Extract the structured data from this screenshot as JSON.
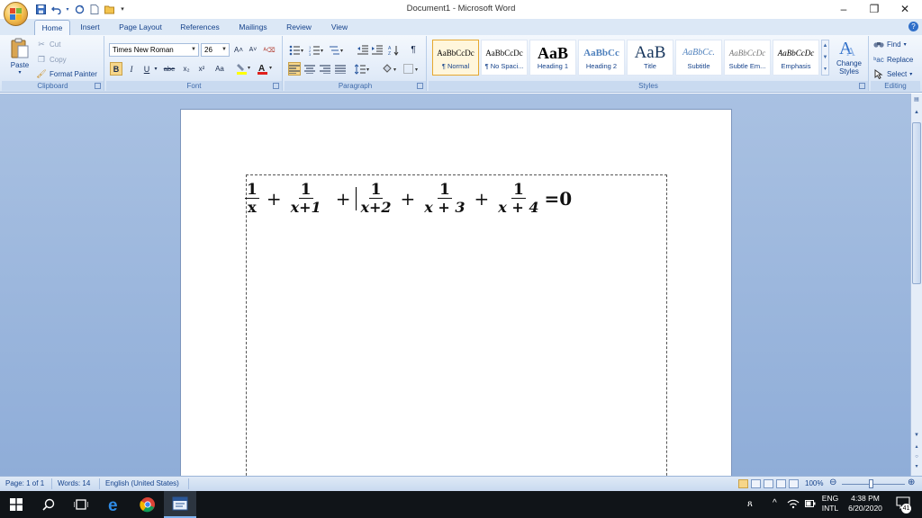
{
  "window": {
    "title": "Document1 - Microsoft Word",
    "minimize": "–",
    "restore": "❐",
    "close": "✕"
  },
  "quick_access": [
    "save-icon",
    "undo-icon",
    "redo-icon",
    "new-icon",
    "open-icon"
  ],
  "tabs": [
    "Home",
    "Insert",
    "Page Layout",
    "References",
    "Mailings",
    "Review",
    "View"
  ],
  "active_tab": "Home",
  "clipboard": {
    "label": "Clipboard",
    "paste": "Paste",
    "cut": "Cut",
    "copy": "Copy",
    "format_painter": "Format Painter"
  },
  "font": {
    "label": "Font",
    "family": "Times New Roman",
    "size": "26",
    "bold": "B",
    "italic": "I",
    "underline": "U",
    "strike": "abe",
    "subscript": "x₂",
    "superscript": "x²",
    "change_case": "Aa",
    "grow": "A˄",
    "shrink": "A˅",
    "clear": "ᴬ⌫"
  },
  "paragraph": {
    "label": "Paragraph",
    "pilcrow": "¶"
  },
  "styles": {
    "label": "Styles",
    "items": [
      {
        "sample": "AaBbCcDc",
        "name": "¶ Normal",
        "selected": true
      },
      {
        "sample": "AaBbCcDc",
        "name": "¶ No Spaci...",
        "selected": false
      },
      {
        "sample": "AaB",
        "name": "Heading 1",
        "selected": false
      },
      {
        "sample": "AaBbCc",
        "name": "Heading 2",
        "selected": false
      },
      {
        "sample": "AaB",
        "name": "Title",
        "selected": false
      },
      {
        "sample": "AaBbCc.",
        "name": "Subtitle",
        "selected": false
      },
      {
        "sample": "AaBbCcDc",
        "name": "Subtle Em...",
        "selected": false
      },
      {
        "sample": "AaBbCcDc",
        "name": "Emphasis",
        "selected": false
      }
    ],
    "change_styles": "Change Styles"
  },
  "editing": {
    "label": "Editing",
    "find": "Find",
    "replace": "Replace",
    "select": "Select"
  },
  "equation": {
    "terms": [
      {
        "num": "1",
        "den": "x"
      },
      {
        "num": "1",
        "den": "x+1"
      },
      {
        "num": "1",
        "den": "x+2"
      },
      {
        "num": "1",
        "den": "x + 3"
      },
      {
        "num": "1",
        "den": "x + 4"
      }
    ],
    "plus": "+",
    "tail": "=0"
  },
  "status": {
    "page": "Page: 1 of 1",
    "words": "Words: 14",
    "language": "English (United States)",
    "zoom": "100%"
  },
  "taskbar": {
    "lang_top": "ENG",
    "lang_bottom": "INTL",
    "time": "4:38 PM",
    "date": "6/20/2020",
    "notifications": "41"
  }
}
